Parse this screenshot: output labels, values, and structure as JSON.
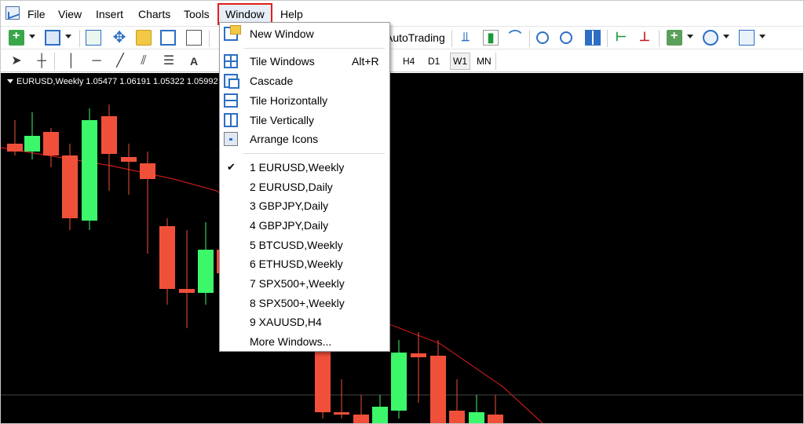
{
  "menubar": {
    "items": [
      "File",
      "View",
      "Insert",
      "Charts",
      "Tools",
      "Window",
      "Help"
    ]
  },
  "toolbar": {
    "autotrading_label": "AutoTrading",
    "timeframes": [
      "H4",
      "D1",
      "W1",
      "MN"
    ],
    "active_timeframe": "W1",
    "text_tool_label": "A"
  },
  "chart": {
    "header": "EURUSD,Weekly  1.05477 1.06191 1.05322 1.05992",
    "bull_color": "#3cf76a",
    "bear_color": "#f0503a",
    "ma_color": "#c21a1a"
  },
  "window_menu": {
    "items": [
      {
        "label": "New Window",
        "icon": "new-window-icon"
      },
      {
        "label": "Tile Windows",
        "shortcut": "Alt+R",
        "icon": "tile-windows-icon"
      },
      {
        "label": "Cascade",
        "icon": "cascade-icon"
      },
      {
        "label": "Tile Horizontally",
        "icon": "tile-horizontally-icon"
      },
      {
        "label": "Tile Vertically",
        "icon": "tile-vertically-icon"
      },
      {
        "label": "Arrange Icons",
        "icon": "arrange-icons-icon"
      }
    ],
    "windows": [
      {
        "label": "1 EURUSD,Weekly",
        "checked": true
      },
      {
        "label": "2 EURUSD,Daily"
      },
      {
        "label": "3 GBPJPY,Daily"
      },
      {
        "label": "4 GBPJPY,Daily"
      },
      {
        "label": "5 BTCUSD,Weekly"
      },
      {
        "label": "6 ETHUSD,Weekly"
      },
      {
        "label": "7 SPX500+,Weekly"
      },
      {
        "label": "8 SPX500+,Weekly"
      },
      {
        "label": "9 XAUUSD,H4"
      }
    ],
    "more_windows": "More Windows..."
  }
}
